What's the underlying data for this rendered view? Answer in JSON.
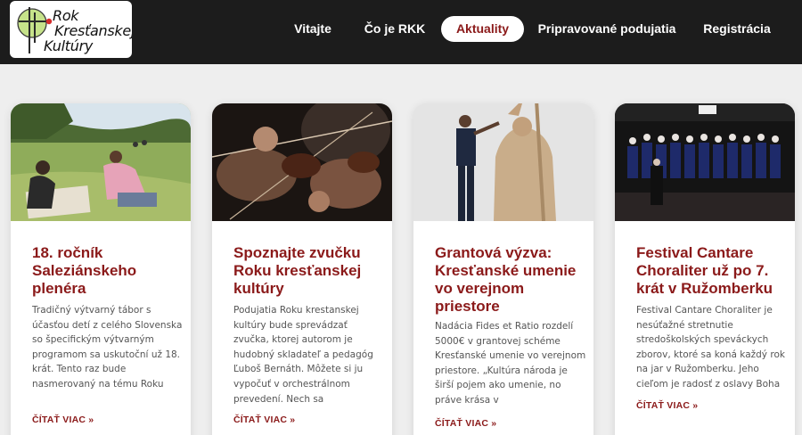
{
  "brand": {
    "line1": "Rok",
    "line2": "Kresťanskej",
    "line3": "Kultúry"
  },
  "nav": [
    "Vitajte",
    "Čo je RKK",
    "Aktuality",
    "Pripravované podujatia",
    "Registrácia"
  ],
  "active_nav": "Aktuality",
  "colors": {
    "accent": "#8b1a1a",
    "header_bg": "#1c1c1c",
    "page_bg": "#eeeeee"
  },
  "posts": [
    {
      "title": "18. ročník Saleziánskeho plenéra",
      "excerpt": "Tradičný výtvarný tábor s účasťou detí z celého Slovenska so špecifickým výtvarným programom sa uskutoční už 18. krát. Tento raz bude nasmerovaný na tému Roku",
      "read_more": "ČÍTAŤ VIAC »"
    },
    {
      "title": "Spoznajte zvučku Roku kresťanskej kultúry",
      "excerpt": "Podujatia Roku krestanskej kultúry bude sprevádzať zvučka, ktorej autorom je hudobný skladateľ a pedagóg Ľuboš Bernáth. Môžete si ju vypočuť v orchestrálnom prevedení. Nech sa",
      "read_more": "ČÍTAŤ VIAC »"
    },
    {
      "title": "Grantová výzva: Kresťanské umenie vo verejnom priestore",
      "excerpt": "Nadácia Fides et Ratio rozdelí 5000€ v grantovej schéme Kresťanské umenie vo verejnom priestore. „Kultúra národa je širší pojem ako umenie, no práve krása v",
      "read_more": "ČÍTAŤ VIAC »"
    },
    {
      "title": "Festival Cantare Choraliter už po 7. krát v Ružomberku",
      "excerpt": "Festival Cantare Choraliter je nesúťažné stretnutie stredoškolských speváckych zborov, ktoré sa koná každý rok na jar v Ružomberku. Jeho cieľom je radosť z oslavy Boha",
      "read_more": "ČÍTAŤ VIAC »"
    }
  ]
}
